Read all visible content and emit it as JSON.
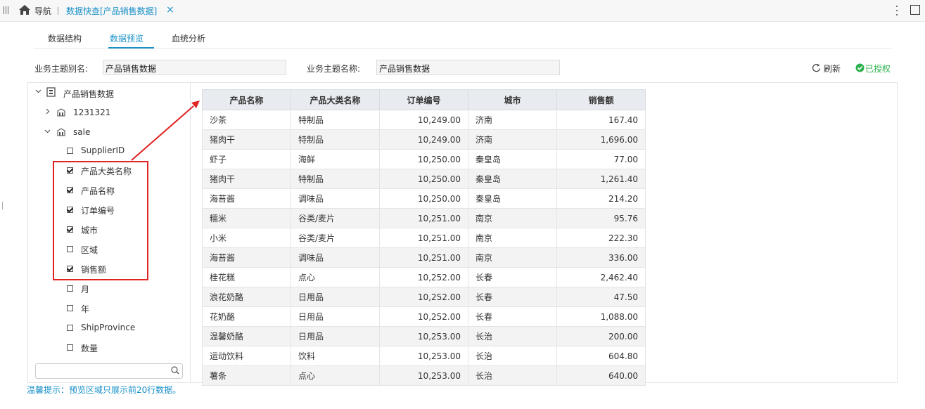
{
  "topbar": {
    "nav_label": "导航",
    "active_tab_label": "数据快查[产品销售数据]",
    "close_symbol": "×"
  },
  "subtabs": [
    "数据结构",
    "数据预览",
    "血统分析"
  ],
  "active_subtab": "数据预览",
  "form": {
    "alias_label": "业务主题别名:",
    "alias_value": "产品销售数据",
    "name_label": "业务主题名称:",
    "name_value": "产品销售数据"
  },
  "actions": {
    "refresh_label": "刷新",
    "authorized_label": "已授权"
  },
  "colors": {
    "accent": "#1890c8",
    "auth": "#2bb24c",
    "highlight": "#e02424"
  },
  "tree": {
    "root": "产品销售数据",
    "nodes": [
      "1231321",
      "sale"
    ],
    "fields": [
      {
        "label": "SupplierID",
        "checked": false
      },
      {
        "label": "产品大类名称",
        "checked": true
      },
      {
        "label": "产品名称",
        "checked": true
      },
      {
        "label": "订单编号",
        "checked": true
      },
      {
        "label": "城市",
        "checked": true
      },
      {
        "label": "区域",
        "checked": false
      },
      {
        "label": "销售额",
        "checked": true
      },
      {
        "label": "月",
        "checked": false
      },
      {
        "label": "年",
        "checked": false
      },
      {
        "label": "ShipProvince",
        "checked": false
      },
      {
        "label": "数量",
        "checked": false
      }
    ]
  },
  "table": {
    "headers": [
      "产品名称",
      "产品大类名称",
      "订单编号",
      "城市",
      "销售额"
    ],
    "rows": [
      [
        "沙茶",
        "特制品",
        "10,249.00",
        "济南",
        "167.40"
      ],
      [
        "猪肉干",
        "特制品",
        "10,249.00",
        "济南",
        "1,696.00"
      ],
      [
        "虾子",
        "海鲜",
        "10,250.00",
        "秦皇岛",
        "77.00"
      ],
      [
        "猪肉干",
        "特制品",
        "10,250.00",
        "秦皇岛",
        "1,261.40"
      ],
      [
        "海苔酱",
        "调味品",
        "10,250.00",
        "秦皇岛",
        "214.20"
      ],
      [
        "糯米",
        "谷类/麦片",
        "10,251.00",
        "南京",
        "95.76"
      ],
      [
        "小米",
        "谷类/麦片",
        "10,251.00",
        "南京",
        "222.30"
      ],
      [
        "海苔酱",
        "调味品",
        "10,251.00",
        "南京",
        "336.00"
      ],
      [
        "桂花糕",
        "点心",
        "10,252.00",
        "长春",
        "2,462.40"
      ],
      [
        "浪花奶酪",
        "日用品",
        "10,252.00",
        "长春",
        "47.50"
      ],
      [
        "花奶酪",
        "日用品",
        "10,252.00",
        "长春",
        "1,088.00"
      ],
      [
        "温馨奶酪",
        "日用品",
        "10,253.00",
        "长治",
        "200.00"
      ],
      [
        "运动饮料",
        "饮料",
        "10,253.00",
        "长治",
        "604.80"
      ],
      [
        "薯条",
        "点心",
        "10,253.00",
        "长治",
        "640.00"
      ]
    ]
  },
  "tip": "温馨提示：预览区域只展示前20行数据。"
}
